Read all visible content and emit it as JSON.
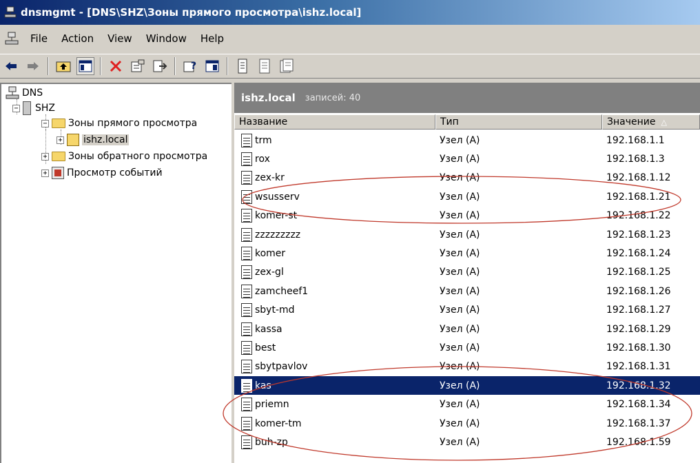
{
  "window": {
    "title": "dnsmgmt - [DNS\\SHZ\\Зоны прямого просмотра\\ishz.local]"
  },
  "menu": [
    "File",
    "Action",
    "View",
    "Window",
    "Help"
  ],
  "toolbar": {
    "buttons": [
      "back-icon",
      "forward-icon",
      "up-level-icon",
      "show-hide-tree-icon",
      "delete-icon",
      "properties-icon",
      "export-list-icon",
      "help-icon",
      "show-hide-action-pane-icon",
      "new-host-icon",
      "new-alias-icon",
      "new-mail-exchanger-icon"
    ]
  },
  "tree": {
    "root": "DNS",
    "server": "SHZ",
    "forward_zones": "Зоны прямого просмотра",
    "zone": "ishz.local",
    "reverse_zones": "Зоны обратного просмотра",
    "events": "Просмотр событий"
  },
  "pane": {
    "zone_name": "ishz.local",
    "record_count": "записей: 40",
    "columns": {
      "name": "Название",
      "type": "Тип",
      "value": "Значение"
    },
    "sort_indicator": "△"
  },
  "records": [
    {
      "name": "trm",
      "type": "Узел (A)",
      "value": "192.168.1.1"
    },
    {
      "name": "rox",
      "type": "Узел (A)",
      "value": "192.168.1.3"
    },
    {
      "name": "zex-kr",
      "type": "Узел (A)",
      "value": "192.168.1.12"
    },
    {
      "name": "wsusserv",
      "type": "Узел (A)",
      "value": "192.168.1.21"
    },
    {
      "name": "komer-st",
      "type": "Узел (A)",
      "value": "192.168.1.22"
    },
    {
      "name": "zzzzzzzzz",
      "type": "Узел (A)",
      "value": "192.168.1.23"
    },
    {
      "name": "komer",
      "type": "Узел (A)",
      "value": "192.168.1.24"
    },
    {
      "name": "zex-gl",
      "type": "Узел (A)",
      "value": "192.168.1.25"
    },
    {
      "name": "zamcheef1",
      "type": "Узел (A)",
      "value": "192.168.1.26"
    },
    {
      "name": "sbyt-md",
      "type": "Узел (A)",
      "value": "192.168.1.27"
    },
    {
      "name": "kassa",
      "type": "Узел (A)",
      "value": "192.168.1.29"
    },
    {
      "name": "best",
      "type": "Узел (A)",
      "value": "192.168.1.30"
    },
    {
      "name": "sbytpavlov",
      "type": "Узел (A)",
      "value": "192.168.1.31"
    },
    {
      "name": "kas",
      "type": "Узел (A)",
      "value": "192.168.1.32",
      "selected": true
    },
    {
      "name": "priemn",
      "type": "Узел (A)",
      "value": "192.168.1.34"
    },
    {
      "name": "komer-tm",
      "type": "Узел (A)",
      "value": "192.168.1.37"
    },
    {
      "name": "buh-zp",
      "type": "Узел (A)",
      "value": "192.168.1.59"
    }
  ],
  "colors": {
    "title_gradient_start": "#0a246a",
    "title_gradient_end": "#a6caf0",
    "selection": "#0a246a",
    "annotation_ellipse": "#c0392b"
  }
}
